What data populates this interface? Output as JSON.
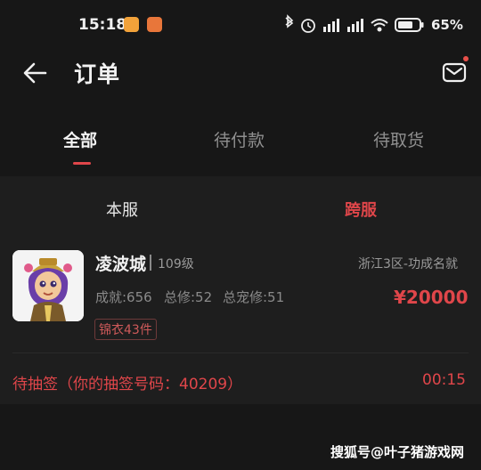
{
  "status_bar": {
    "time": "15:18",
    "battery_percent": "65%"
  },
  "header": {
    "title": "订单"
  },
  "tabs": [
    {
      "label": "全部",
      "active": true
    },
    {
      "label": "待付款",
      "active": false
    },
    {
      "label": "待取货",
      "active": false
    }
  ],
  "segments": {
    "local": "本服",
    "cross": "跨服"
  },
  "order": {
    "name": "凌波城",
    "level": "109级",
    "server": "浙江3区-功成名就",
    "stats": [
      "成就:656",
      "总修:52",
      "总宠修:51"
    ],
    "price": "¥20000",
    "tag": "锦衣43件",
    "status": "待抽签（你的抽签号码：40209）",
    "countdown": "00:15"
  },
  "watermark": "搜狐号@叶子猪游戏网",
  "colors": {
    "accent": "#e0464a",
    "background": "#171717"
  }
}
